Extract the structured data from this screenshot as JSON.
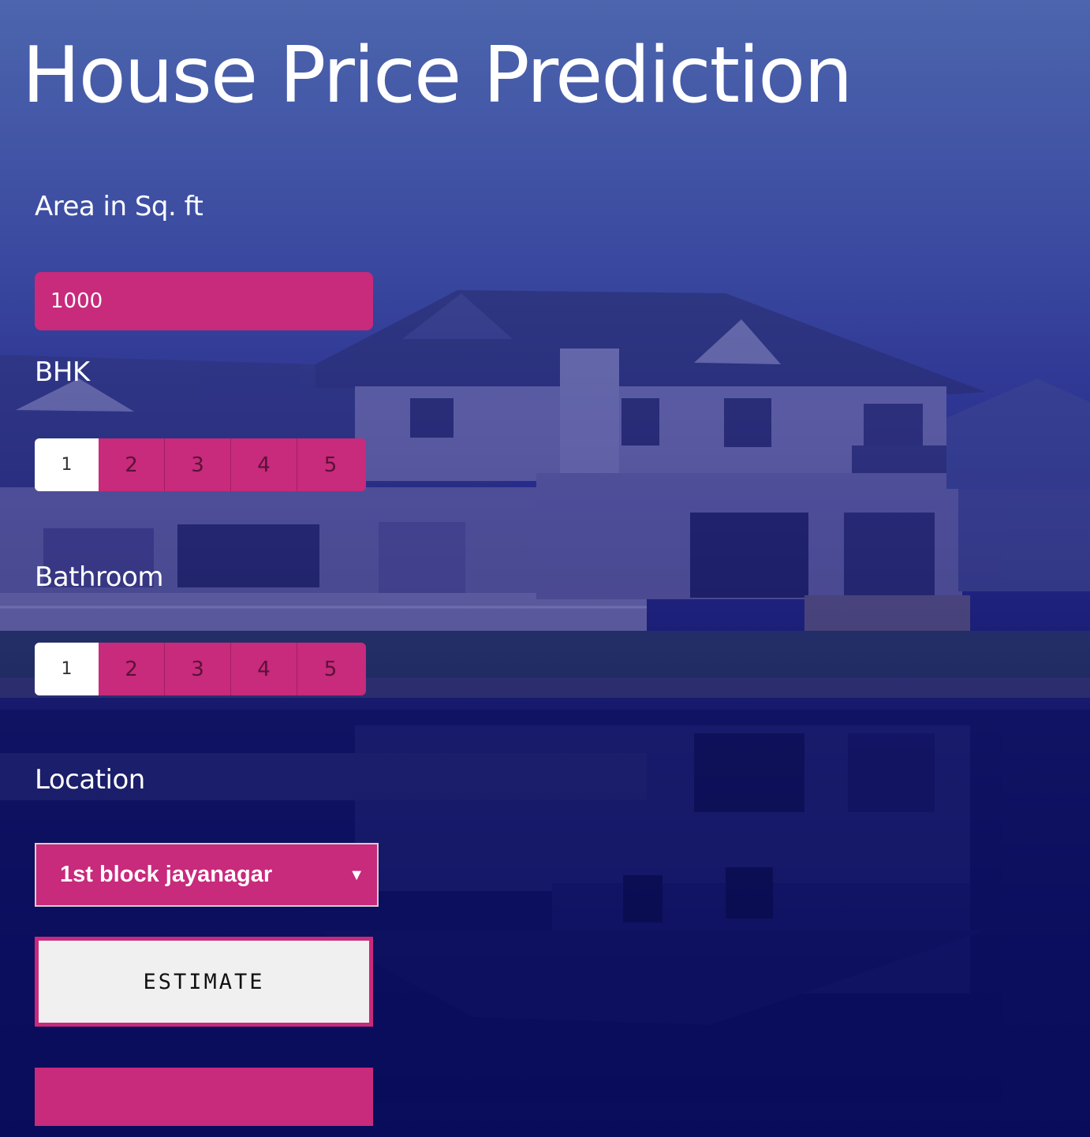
{
  "page": {
    "title": "House Price Prediction"
  },
  "area": {
    "label": "Area in Sq. ft",
    "value": "1000"
  },
  "bhk": {
    "label": "BHK",
    "options": [
      "1",
      "2",
      "3",
      "4",
      "5"
    ],
    "selected": "1"
  },
  "bathroom": {
    "label": "Bathroom",
    "options": [
      "1",
      "2",
      "3",
      "4",
      "5"
    ],
    "selected": "1"
  },
  "location": {
    "label": "Location",
    "selected": "1st block jayanagar",
    "arrow": "▼"
  },
  "estimate": {
    "button_label": "ESTIMATE"
  },
  "result": {
    "text": ""
  },
  "colors": {
    "accent": "#c82a7c",
    "background_top": "#4c65ad",
    "background_bottom": "#060958",
    "text": "#ffffff"
  },
  "icons": {
    "dropdown": "dropdown-arrow-icon"
  }
}
